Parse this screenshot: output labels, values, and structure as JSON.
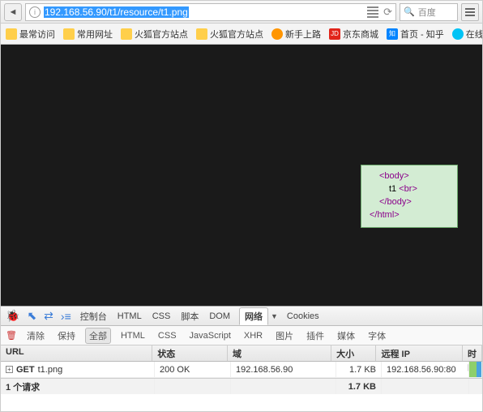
{
  "address": {
    "url": "192.168.56.90/t1/resource/t1.png",
    "search_placeholder": "百度"
  },
  "bookmarks": [
    {
      "label": "最常访问",
      "kind": "fold"
    },
    {
      "label": "常用网址",
      "kind": "fold"
    },
    {
      "label": "火狐官方站点",
      "kind": "fold"
    },
    {
      "label": "火狐官方站点",
      "kind": "fold"
    },
    {
      "label": "新手上路",
      "kind": "ff"
    },
    {
      "label": "京东商城",
      "kind": "jd",
      "badge": "JD"
    },
    {
      "label": "首页 - 知乎",
      "kind": "zh",
      "badge": "知"
    },
    {
      "label": "在线API文",
      "kind": "c"
    }
  ],
  "tooltip": {
    "line1": "<body>",
    "line2": "t1 ",
    "line2_tag": "<br>",
    "line3": "</body>",
    "line4": "</html>"
  },
  "devtools": {
    "tabs": [
      "控制台",
      "HTML",
      "CSS",
      "脚本",
      "DOM",
      "网络",
      "Cookies"
    ],
    "active_tab": "网络",
    "filters": {
      "clear": "清除",
      "keep": "保持",
      "all": "全部",
      "html": "HTML",
      "css": "CSS",
      "js": "JavaScript",
      "xhr": "XHR",
      "img": "图片",
      "plugin": "插件",
      "media": "媒体",
      "font": "字体"
    },
    "headers": {
      "url": "URL",
      "status": "状态",
      "domain": "域",
      "size": "大小",
      "ip": "远程 IP",
      "timeline": "时间线"
    },
    "rows": [
      {
        "method": "GET",
        "file": "t1.png",
        "status": "200 OK",
        "domain": "192.168.56.90",
        "size": "1.7 KB",
        "ip": "192.168.56.90:80"
      }
    ],
    "summary": {
      "label": "1 个请求",
      "size": "1.7 KB"
    }
  }
}
